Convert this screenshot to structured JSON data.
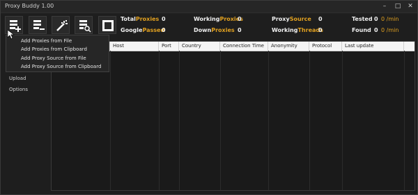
{
  "window": {
    "title": "Proxy Buddy 1.00"
  },
  "titlebar_controls": {
    "minimize": "–",
    "maximize": "□",
    "close": "✕"
  },
  "toolbar": {
    "buttons": [
      {
        "name": "add-proxies-icon"
      },
      {
        "name": "remove-list-icon"
      },
      {
        "name": "magic-wand-icon"
      },
      {
        "name": "search-list-icon"
      },
      {
        "name": "stop-icon"
      }
    ]
  },
  "stats": {
    "total_proxies": {
      "label_a": "Total",
      "label_b": "Proxies",
      "value": "0"
    },
    "google_passed": {
      "label_a": "Google",
      "label_b": "Passed",
      "value": "0"
    },
    "working_proxies": {
      "label_a": "Working",
      "label_b": "Proxies",
      "value": "0"
    },
    "down_proxies": {
      "label_a": "Down",
      "label_b": "Proxies",
      "value": "0"
    },
    "proxy_source": {
      "label_a": "Proxy",
      "label_b": "Source",
      "value": "0"
    },
    "working_threads": {
      "label_a": "Working",
      "label_b": "Threads",
      "value": "0"
    },
    "tested": {
      "label": "Tested",
      "value": "0",
      "rate": "0 /min"
    },
    "found": {
      "label": "Found",
      "value": "0",
      "rate": "0 /min"
    }
  },
  "sidebar": {
    "items": [
      "Upload",
      "Options"
    ]
  },
  "grid": {
    "columns": [
      "Host",
      "Port",
      "Country",
      "Connection Time",
      "Anonymity",
      "Protocol",
      "Last update"
    ]
  },
  "menu": {
    "items": [
      "Add Proxies from File",
      "Add Proxies from Clipboard",
      "Add Proxy Source from File",
      "Add Proxy Source from Clipboard"
    ]
  },
  "colors": {
    "accent": "#e0a020",
    "background": "#1e1e1e",
    "header": "#f4f4f4"
  }
}
